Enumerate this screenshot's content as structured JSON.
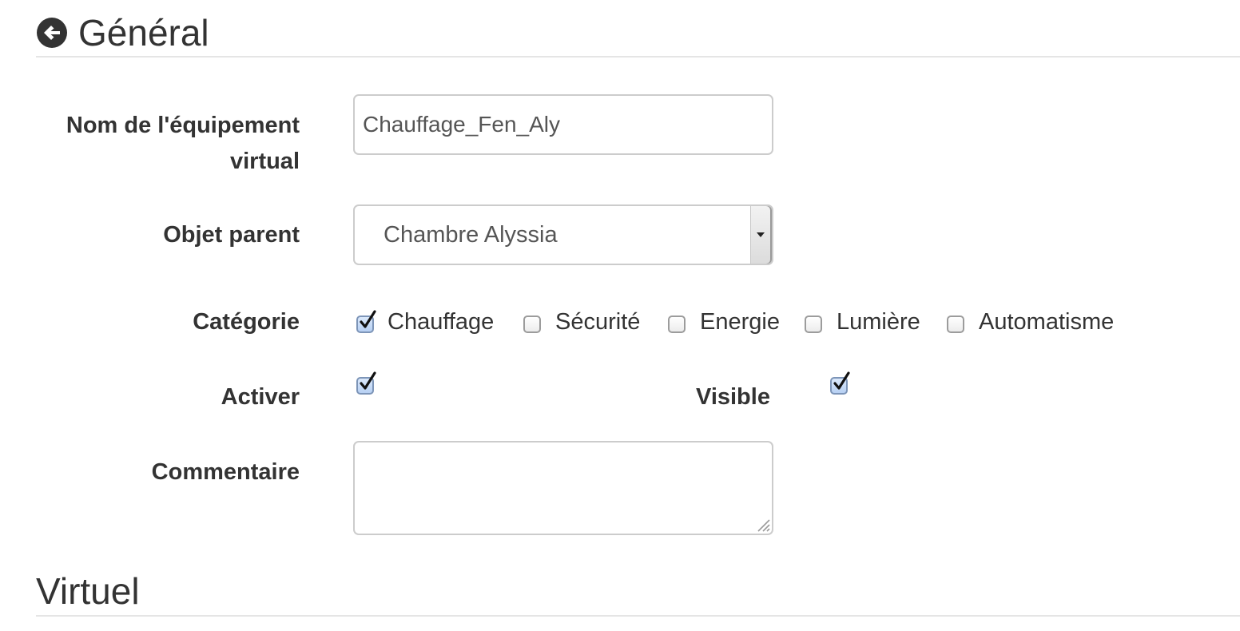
{
  "sections": {
    "general_title": "Général",
    "virtuel_title": "Virtuel"
  },
  "form": {
    "name": {
      "label_line1": "Nom de l'équipement",
      "label_line2": "virtual",
      "value": "Chauffage_Fen_Aly"
    },
    "parent": {
      "label": "Objet parent",
      "selected": "Chambre Alyssia"
    },
    "category": {
      "label": "Catégorie",
      "options": [
        {
          "label": "Chauffage",
          "checked": true
        },
        {
          "label": "Sécurité",
          "checked": false
        },
        {
          "label": "Energie",
          "checked": false
        },
        {
          "label": "Lumière",
          "checked": false
        },
        {
          "label": "Automatisme",
          "checked": false
        }
      ]
    },
    "activer": {
      "label": "Activer",
      "checked": true
    },
    "visible": {
      "label": "Visible",
      "checked": true
    },
    "comment": {
      "label": "Commentaire",
      "value": ""
    }
  },
  "icons": {
    "back": "circle-arrow-left-icon",
    "check": "checkmark-icon",
    "resize": "resize-grip-icon",
    "select_arrow": "caret-down-icon"
  },
  "colors": {
    "text": "#333333",
    "input_border": "#cccccc",
    "divider": "#e5e5e5",
    "checkbox_checked": "#b7d0f3"
  }
}
